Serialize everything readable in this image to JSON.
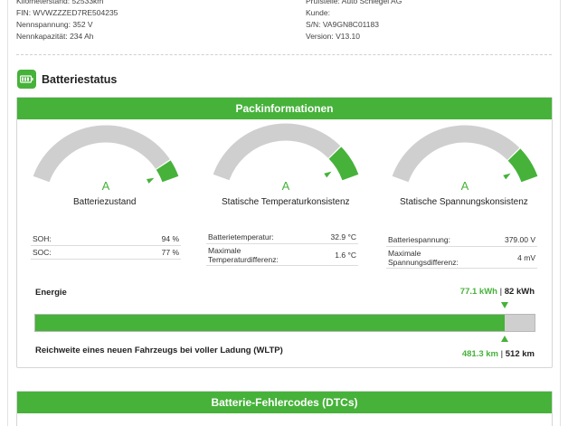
{
  "meta": {
    "left": [
      "Kilometerstand: 52533km",
      "FIN: WVWZZZED7RE504235",
      "Nennspannung: 352 V",
      "Nennkapazität: 234 Ah"
    ],
    "right": [
      "Prüfstelle: Auto Schlegel AG",
      "Kunde:",
      "S/N: VA9GN8C01183",
      "Version: V13.10"
    ]
  },
  "section": {
    "title": "Batteriestatus",
    "icon": "battery-icon"
  },
  "pack": {
    "header": "Packinformationen",
    "gauges": [
      {
        "grade": "A",
        "label": "Batteriezustand",
        "level": 0.9
      },
      {
        "grade": "A",
        "label": "Statische Temperaturkonsistenz",
        "level": 0.82
      },
      {
        "grade": "A",
        "label": "Statische Spannungskonsistenz",
        "level": 0.82
      }
    ],
    "table_soh": [
      {
        "key": "SOH:",
        "value": "94 %"
      },
      {
        "key": "SOC:",
        "value": "77 %"
      }
    ],
    "table_temp": [
      {
        "key": "Batterietemperatur:",
        "value": "32.9 °C"
      },
      {
        "key": "Maximale Temperaturdifferenz:",
        "value": "1.6 °C"
      }
    ],
    "table_volt": [
      {
        "key": "Batteriespannung:",
        "value": "379.00 V"
      },
      {
        "key": "Maximale Spannungsdifferenz:",
        "value": "4 mV"
      }
    ],
    "energy": {
      "label": "Energie",
      "current": "77.1 kWh",
      "separator": "|",
      "total": "82 kWh",
      "fraction": 0.94
    },
    "range": {
      "label": "Reichweite eines neuen Fahrzeugs bei voller Ladung (WLTP)",
      "current": "481.3 km",
      "separator": "|",
      "total": "512 km"
    }
  },
  "dtc": {
    "header": "Batterie-Fehlercodes (DTCs)"
  },
  "colors": {
    "accent": "#46b23a",
    "track": "#cfcfcf"
  }
}
